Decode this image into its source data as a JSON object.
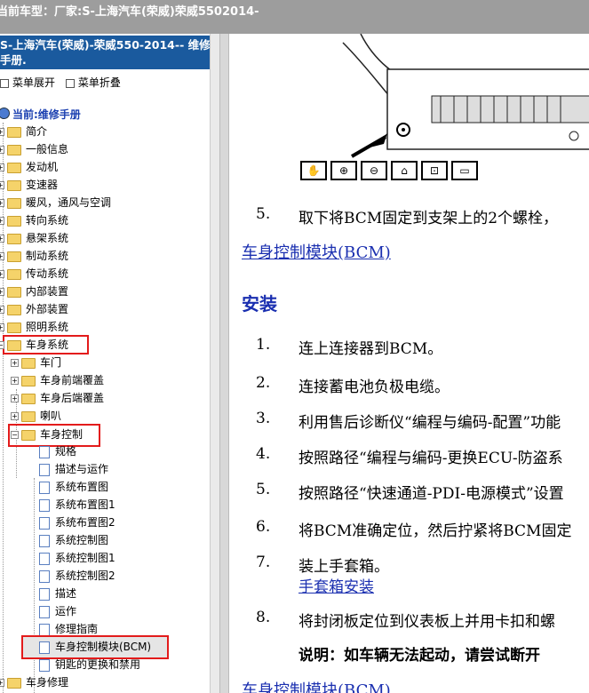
{
  "topbar": {
    "text": "当前车型：厂家:S-上海汽车(荣威)荣威5502014-"
  },
  "left": {
    "title_line1": "S-上海汽车(荣威)-荣威550-2014-- 维修",
    "title_line2": "手册.",
    "expand_label": "菜单展开",
    "collapse_label": "菜单折叠",
    "current_label": "当前:维修手册"
  },
  "tree": [
    {
      "label": "简介"
    },
    {
      "label": "一般信息"
    },
    {
      "label": "发动机"
    },
    {
      "label": "变速器"
    },
    {
      "label": "暖风，通风与空调"
    },
    {
      "label": "转向系统"
    },
    {
      "label": "悬架系统"
    },
    {
      "label": "制动系统"
    },
    {
      "label": "传动系统"
    },
    {
      "label": "内部装置"
    },
    {
      "label": "外部装置"
    },
    {
      "label": "照明系统"
    },
    {
      "label": "车身系统"
    },
    {
      "label": "车门"
    },
    {
      "label": "车身前端覆盖"
    },
    {
      "label": "车身后端覆盖"
    },
    {
      "label": "喇叭"
    },
    {
      "label": "车身控制"
    },
    {
      "label": "规格"
    },
    {
      "label": "描述与运作"
    },
    {
      "label": "系统布置图"
    },
    {
      "label": "系统布置图1"
    },
    {
      "label": "系统布置图2"
    },
    {
      "label": "系统控制图"
    },
    {
      "label": "系统控制图1"
    },
    {
      "label": "系统控制图2"
    },
    {
      "label": "描述"
    },
    {
      "label": "运作"
    },
    {
      "label": "修理指南"
    },
    {
      "label": "车身控制模块(BCM)"
    },
    {
      "label": "钥匙的更换和禁用"
    },
    {
      "label": "车身修理"
    }
  ],
  "content": {
    "step5_num": "5.",
    "step5_text": "取下将BCM固定到支架上的2个螺栓，",
    "section_link": "车身控制模块(BCM)",
    "install_heading": "安装",
    "steps": [
      {
        "num": "1.",
        "text": "连上连接器到BCM。"
      },
      {
        "num": "2.",
        "text": "连接蓄电池负极电缆。"
      },
      {
        "num": "3.",
        "text": "利用售后诊断仪“编程与编码-配置”功能"
      },
      {
        "num": "4.",
        "text": "按照路径“编程与编码-更换ECU-防盗系"
      },
      {
        "num": "5.",
        "text": "按照路径“快速通道-PDI-电源模式”设置"
      },
      {
        "num": "6.",
        "text": "将BCM准确定位，然后拧紧将BCM固定"
      },
      {
        "num": "7.",
        "text": "装上手套箱。"
      },
      {
        "num": "8.",
        "text": "将封闭板定位到仪表板上并用卡扣和螺"
      }
    ],
    "glovebox_link": "手套箱安装",
    "note": "说明：如车辆无法起动，请尝试断开",
    "bottom_link": "车身控制模块(BCM)"
  },
  "toolbar": [
    "hand-icon",
    "zoom-in-icon",
    "zoom-out-icon",
    "home-icon",
    "fit-icon",
    "window-icon"
  ]
}
